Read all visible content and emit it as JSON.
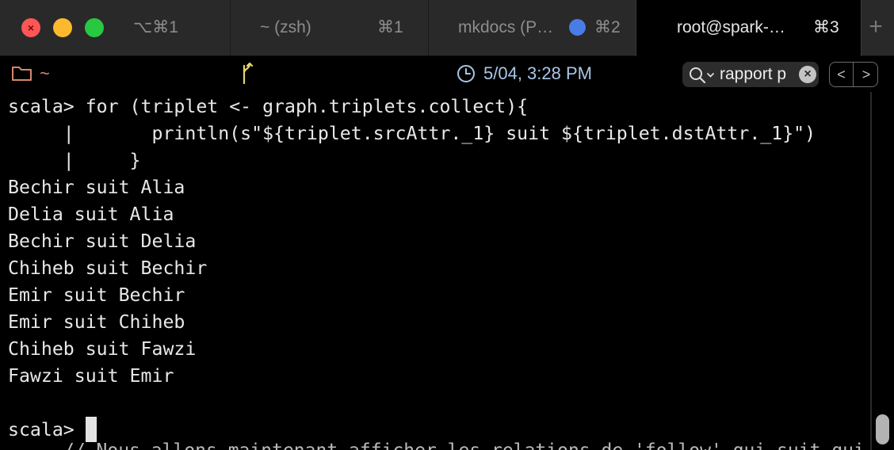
{
  "window": {
    "traffic_lights": {
      "close_color": "#fd5655",
      "minimize_color": "#fcb92e",
      "maximize_color": "#28c940"
    },
    "close_glyph": "×"
  },
  "tabs": [
    {
      "label": "⌥⌘1",
      "shortcut": "",
      "active": false
    },
    {
      "label": "~ (zsh)",
      "shortcut": "⌘1",
      "active": false
    },
    {
      "label": "mkdocs (P…",
      "shortcut": "⌘2",
      "active": false,
      "activity_dot_color": "#4a7ce6"
    },
    {
      "label": "root@spark-…",
      "shortcut": "⌘3",
      "active": true
    }
  ],
  "new_tab_label": "+",
  "statusbar": {
    "folder_icon": "folder-icon",
    "cwd": "~",
    "git_icon": "git-branch-icon",
    "clock_icon": "clock-icon",
    "timestamp": "5/04, 3:28 PM",
    "search": {
      "icon": "search-icon",
      "value": "rapport p",
      "clear_glyph": "×"
    },
    "nav": {
      "prev": "<",
      "next": ">"
    }
  },
  "terminal": {
    "lines": [
      "scala> for (triplet <- graph.triplets.collect){",
      "     |       println(s\"${triplet.srcAttr._1} suit ${triplet.dstAttr._1}\")",
      "     |     }",
      "Bechir suit Alia",
      "Delia suit Alia",
      "Bechir suit Delia",
      "Chiheb suit Bechir",
      "Emir suit Bechir",
      "Emir suit Chiheb",
      "Chiheb suit Fawzi",
      "Fawzi suit Emir",
      "",
      "scala> "
    ],
    "background_text": "// Nous allons maintenant afficher les relations de 'follow' qui suit qui"
  },
  "colors": {
    "accent_cwd": "#d9866c",
    "timestamp": "#a9c6e6",
    "terminal_fg": "#e8e8e8"
  }
}
